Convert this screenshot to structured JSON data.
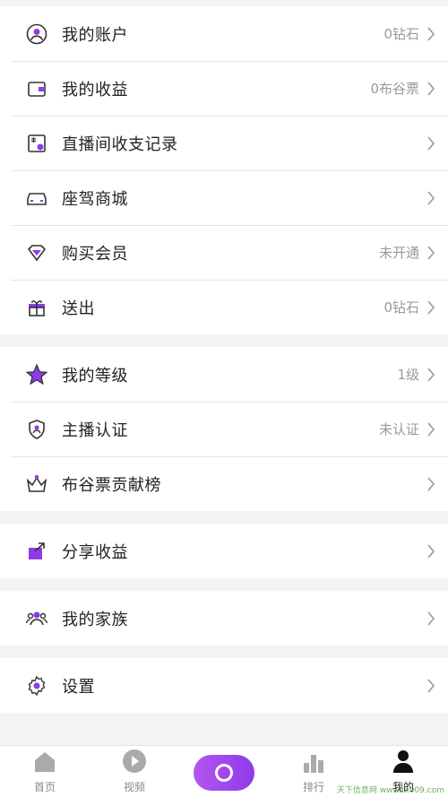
{
  "colors": {
    "accent": "#8e3be8",
    "icon": "#333333",
    "value": "#999999"
  },
  "groups": [
    {
      "items": [
        {
          "label": "我的账户",
          "value": "0钻石",
          "icon": "user-circle-icon"
        },
        {
          "label": "我的收益",
          "value": "0布谷票",
          "icon": "wallet-icon"
        },
        {
          "label": "直播间收支记录",
          "value": "",
          "icon": "ledger-icon"
        },
        {
          "label": "座驾商城",
          "value": "",
          "icon": "car-icon"
        },
        {
          "label": "购买会员",
          "value": "未开通",
          "icon": "diamond-icon"
        },
        {
          "label": "送出",
          "value": "0钻石",
          "icon": "gift-icon"
        }
      ]
    },
    {
      "items": [
        {
          "label": "我的等级",
          "value": "1级",
          "icon": "star-icon"
        },
        {
          "label": "主播认证",
          "value": "未认证",
          "icon": "shield-user-icon"
        },
        {
          "label": "布谷票贡献榜",
          "value": "",
          "icon": "crown-icon"
        }
      ]
    },
    {
      "items": [
        {
          "label": "分享收益",
          "value": "",
          "icon": "share-icon"
        }
      ]
    },
    {
      "items": [
        {
          "label": "我的家族",
          "value": "",
          "icon": "family-icon"
        }
      ]
    },
    {
      "items": [
        {
          "label": "设置",
          "value": "",
          "icon": "gear-icon"
        }
      ]
    }
  ],
  "tabbar": {
    "tabs": [
      {
        "label": "首页",
        "icon": "home-icon"
      },
      {
        "label": "视频",
        "icon": "play-icon"
      },
      {
        "label": "",
        "icon": "live-record-icon"
      },
      {
        "label": "排行",
        "icon": "ranking-icon"
      },
      {
        "label": "我的",
        "icon": "profile-icon"
      }
    ]
  },
  "watermark": "天下信息网 www.tx009.com"
}
